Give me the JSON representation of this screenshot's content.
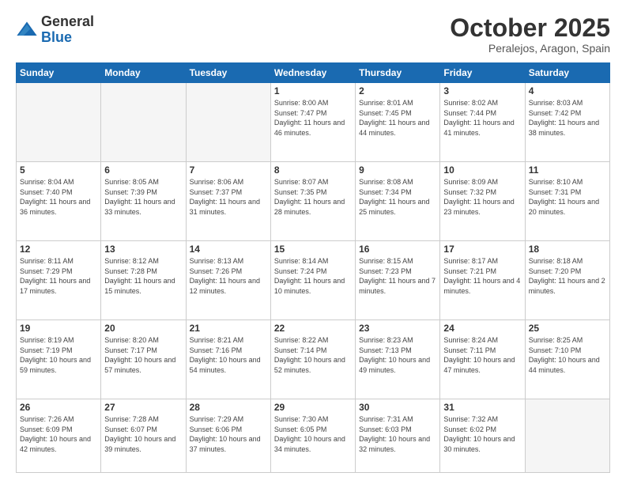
{
  "logo": {
    "general": "General",
    "blue": "Blue"
  },
  "header": {
    "month": "October 2025",
    "location": "Peralejos, Aragon, Spain"
  },
  "weekdays": [
    "Sunday",
    "Monday",
    "Tuesday",
    "Wednesday",
    "Thursday",
    "Friday",
    "Saturday"
  ],
  "weeks": [
    [
      {
        "day": "",
        "info": ""
      },
      {
        "day": "",
        "info": ""
      },
      {
        "day": "",
        "info": ""
      },
      {
        "day": "1",
        "info": "Sunrise: 8:00 AM\nSunset: 7:47 PM\nDaylight: 11 hours and 46 minutes."
      },
      {
        "day": "2",
        "info": "Sunrise: 8:01 AM\nSunset: 7:45 PM\nDaylight: 11 hours and 44 minutes."
      },
      {
        "day": "3",
        "info": "Sunrise: 8:02 AM\nSunset: 7:44 PM\nDaylight: 11 hours and 41 minutes."
      },
      {
        "day": "4",
        "info": "Sunrise: 8:03 AM\nSunset: 7:42 PM\nDaylight: 11 hours and 38 minutes."
      }
    ],
    [
      {
        "day": "5",
        "info": "Sunrise: 8:04 AM\nSunset: 7:40 PM\nDaylight: 11 hours and 36 minutes."
      },
      {
        "day": "6",
        "info": "Sunrise: 8:05 AM\nSunset: 7:39 PM\nDaylight: 11 hours and 33 minutes."
      },
      {
        "day": "7",
        "info": "Sunrise: 8:06 AM\nSunset: 7:37 PM\nDaylight: 11 hours and 31 minutes."
      },
      {
        "day": "8",
        "info": "Sunrise: 8:07 AM\nSunset: 7:35 PM\nDaylight: 11 hours and 28 minutes."
      },
      {
        "day": "9",
        "info": "Sunrise: 8:08 AM\nSunset: 7:34 PM\nDaylight: 11 hours and 25 minutes."
      },
      {
        "day": "10",
        "info": "Sunrise: 8:09 AM\nSunset: 7:32 PM\nDaylight: 11 hours and 23 minutes."
      },
      {
        "day": "11",
        "info": "Sunrise: 8:10 AM\nSunset: 7:31 PM\nDaylight: 11 hours and 20 minutes."
      }
    ],
    [
      {
        "day": "12",
        "info": "Sunrise: 8:11 AM\nSunset: 7:29 PM\nDaylight: 11 hours and 17 minutes."
      },
      {
        "day": "13",
        "info": "Sunrise: 8:12 AM\nSunset: 7:28 PM\nDaylight: 11 hours and 15 minutes."
      },
      {
        "day": "14",
        "info": "Sunrise: 8:13 AM\nSunset: 7:26 PM\nDaylight: 11 hours and 12 minutes."
      },
      {
        "day": "15",
        "info": "Sunrise: 8:14 AM\nSunset: 7:24 PM\nDaylight: 11 hours and 10 minutes."
      },
      {
        "day": "16",
        "info": "Sunrise: 8:15 AM\nSunset: 7:23 PM\nDaylight: 11 hours and 7 minutes."
      },
      {
        "day": "17",
        "info": "Sunrise: 8:17 AM\nSunset: 7:21 PM\nDaylight: 11 hours and 4 minutes."
      },
      {
        "day": "18",
        "info": "Sunrise: 8:18 AM\nSunset: 7:20 PM\nDaylight: 11 hours and 2 minutes."
      }
    ],
    [
      {
        "day": "19",
        "info": "Sunrise: 8:19 AM\nSunset: 7:19 PM\nDaylight: 10 hours and 59 minutes."
      },
      {
        "day": "20",
        "info": "Sunrise: 8:20 AM\nSunset: 7:17 PM\nDaylight: 10 hours and 57 minutes."
      },
      {
        "day": "21",
        "info": "Sunrise: 8:21 AM\nSunset: 7:16 PM\nDaylight: 10 hours and 54 minutes."
      },
      {
        "day": "22",
        "info": "Sunrise: 8:22 AM\nSunset: 7:14 PM\nDaylight: 10 hours and 52 minutes."
      },
      {
        "day": "23",
        "info": "Sunrise: 8:23 AM\nSunset: 7:13 PM\nDaylight: 10 hours and 49 minutes."
      },
      {
        "day": "24",
        "info": "Sunrise: 8:24 AM\nSunset: 7:11 PM\nDaylight: 10 hours and 47 minutes."
      },
      {
        "day": "25",
        "info": "Sunrise: 8:25 AM\nSunset: 7:10 PM\nDaylight: 10 hours and 44 minutes."
      }
    ],
    [
      {
        "day": "26",
        "info": "Sunrise: 7:26 AM\nSunset: 6:09 PM\nDaylight: 10 hours and 42 minutes."
      },
      {
        "day": "27",
        "info": "Sunrise: 7:28 AM\nSunset: 6:07 PM\nDaylight: 10 hours and 39 minutes."
      },
      {
        "day": "28",
        "info": "Sunrise: 7:29 AM\nSunset: 6:06 PM\nDaylight: 10 hours and 37 minutes."
      },
      {
        "day": "29",
        "info": "Sunrise: 7:30 AM\nSunset: 6:05 PM\nDaylight: 10 hours and 34 minutes."
      },
      {
        "day": "30",
        "info": "Sunrise: 7:31 AM\nSunset: 6:03 PM\nDaylight: 10 hours and 32 minutes."
      },
      {
        "day": "31",
        "info": "Sunrise: 7:32 AM\nSunset: 6:02 PM\nDaylight: 10 hours and 30 minutes."
      },
      {
        "day": "",
        "info": ""
      }
    ]
  ]
}
